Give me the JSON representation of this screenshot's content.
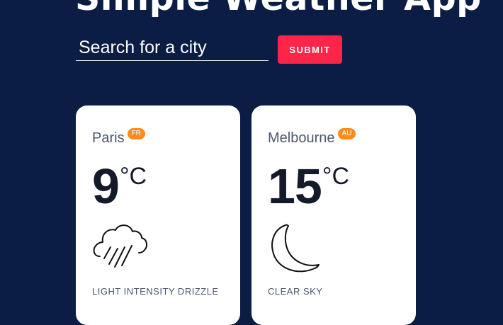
{
  "app": {
    "title": "Simple Weather App"
  },
  "search": {
    "placeholder": "Search for a city",
    "value": "",
    "submit_label": "SUBMIT"
  },
  "cards": [
    {
      "city": "Paris",
      "country": "FR",
      "temperature": "9",
      "unit": "°C",
      "icon": "rain-cloud-icon",
      "description": "LIGHT INTENSITY DRIZZLE"
    },
    {
      "city": "Melbourne",
      "country": "AU",
      "temperature": "15",
      "unit": "°C",
      "icon": "crescent-moon-icon",
      "description": "CLEAR SKY"
    }
  ],
  "colors": {
    "background": "#0c1d45",
    "submit_button": "#ff2548",
    "country_badge": "#ff8c1a",
    "card": "#ffffff",
    "temperature_text": "#151a2b",
    "secondary_text": "#4c566e"
  }
}
